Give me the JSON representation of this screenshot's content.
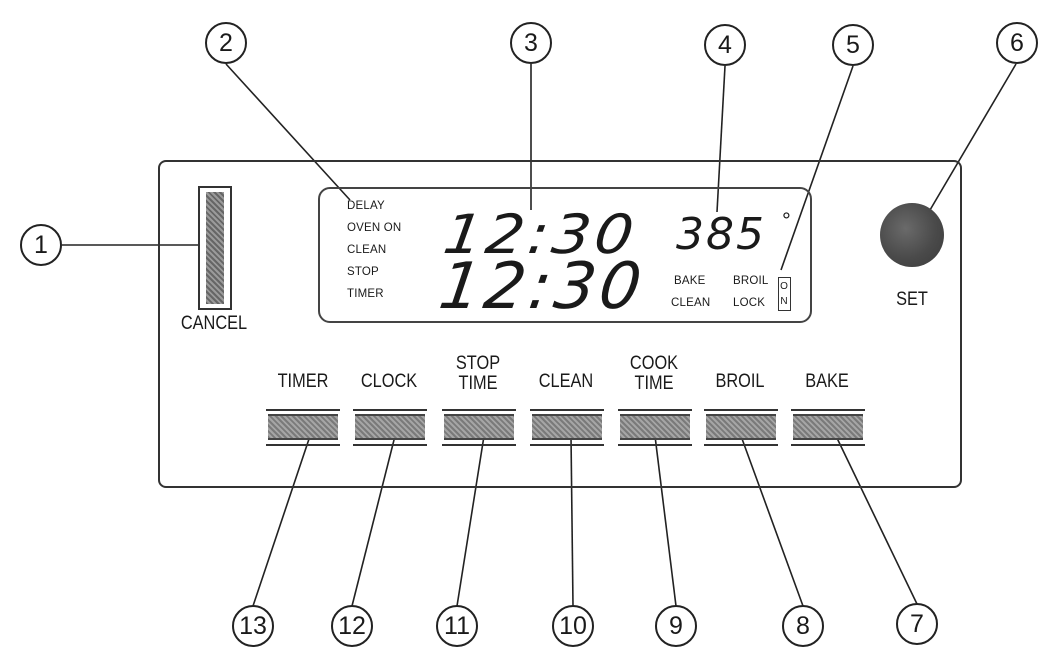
{
  "panel": {
    "cancel_label": "CANCEL",
    "set_label": "SET"
  },
  "display": {
    "indicators_left": [
      "DELAY",
      "OVEN ON",
      "CLEAN",
      "STOP",
      "TIMER"
    ],
    "time_upper": "12:30",
    "time_lower": "12:30",
    "temperature": "385",
    "degree_symbol": "°",
    "mode_left_top": "BAKE",
    "mode_left_bottom": "CLEAN",
    "mode_right_top": "BROIL",
    "mode_right_bottom": "LOCK",
    "on_indicator": "ON"
  },
  "buttons": [
    {
      "label": "TIMER"
    },
    {
      "label": "CLOCK"
    },
    {
      "label": "STOP\nTIME"
    },
    {
      "label": "CLEAN"
    },
    {
      "label": "COOK\nTIME"
    },
    {
      "label": "BROIL"
    },
    {
      "label": "BAKE"
    }
  ],
  "callouts": [
    "1",
    "2",
    "3",
    "4",
    "5",
    "6",
    "7",
    "8",
    "9",
    "10",
    "11",
    "12",
    "13"
  ],
  "colors": {
    "button_fill": "#8f8f8f",
    "set_button": "#4a4a4a"
  }
}
